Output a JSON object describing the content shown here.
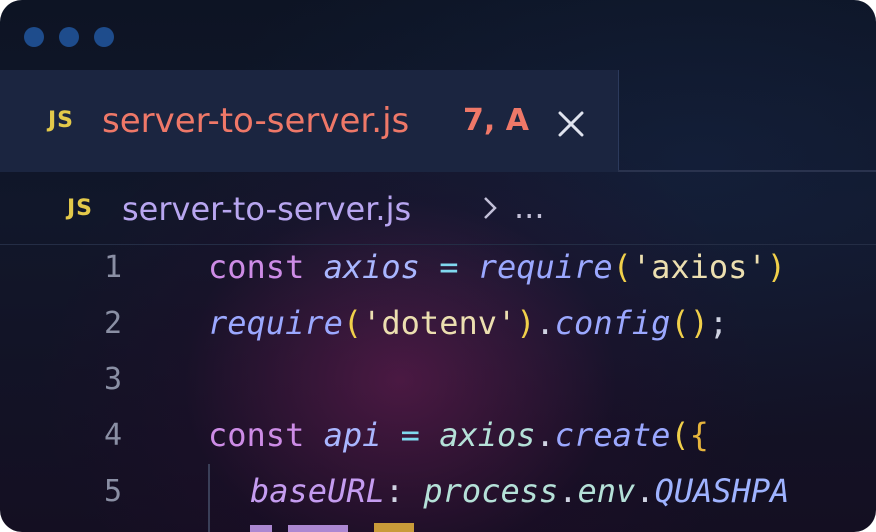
{
  "colors": {
    "window_bg": "#0d1424",
    "tab_active_bg": "#1b2540",
    "tab_title": "#ef7868",
    "js_badge": "#e3c94a",
    "breadcrumb": "#b8a6f0",
    "window_dot": "#1e4c8c"
  },
  "window": {
    "controls": [
      "dot",
      "dot",
      "dot"
    ]
  },
  "tab": {
    "icon_label": "JS",
    "filename": "server-to-server.js",
    "status": "7, A",
    "close_icon": "close-icon"
  },
  "breadcrumb": {
    "icon_label": "JS",
    "filename": "server-to-server.js",
    "separator_icon": "chevron-right-icon",
    "more": "..."
  },
  "editor": {
    "lines": [
      {
        "number": "1",
        "tokens": [
          "const",
          "axios",
          "=",
          "require",
          "(",
          "'axios'",
          ")"
        ]
      },
      {
        "number": "2",
        "tokens": [
          "require",
          "(",
          "'dotenv'",
          ")",
          ".",
          "config",
          "()",
          ";"
        ]
      },
      {
        "number": "3",
        "tokens": []
      },
      {
        "number": "4",
        "tokens": [
          "const",
          "api",
          "=",
          "axios",
          ".",
          "create",
          "(",
          "{"
        ]
      },
      {
        "number": "5",
        "tokens": [
          "baseURL",
          ":",
          "process",
          ".",
          "env",
          ".",
          "QUASHPA"
        ]
      }
    ]
  }
}
